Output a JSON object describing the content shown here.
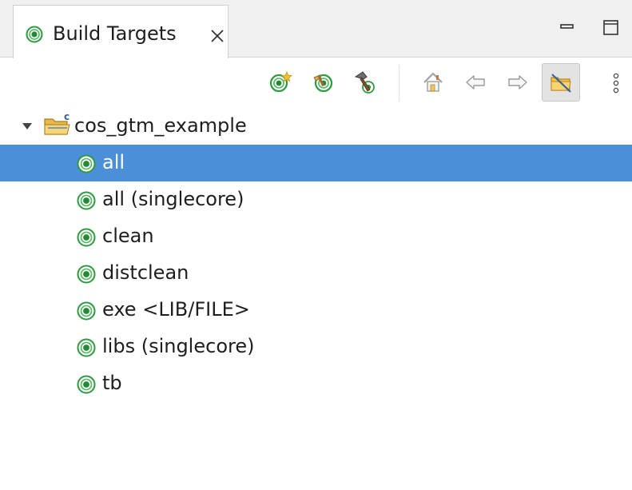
{
  "view": {
    "tab_title": "Build Targets",
    "tab_icon": "build-target-icon",
    "close_icon": "close-icon",
    "minimize_icon": "minimize-icon",
    "maximize_icon": "maximize-icon"
  },
  "toolbar": {
    "buttons": [
      {
        "name": "new-target-icon"
      },
      {
        "name": "edit-target-icon"
      },
      {
        "name": "build-hammer-icon"
      },
      {
        "name": "home-icon"
      },
      {
        "name": "back-arrow-icon"
      },
      {
        "name": "forward-arrow-icon"
      },
      {
        "name": "hide-non-build-folders-icon",
        "active": true
      }
    ],
    "more_icon": "view-menu-icon"
  },
  "tree": {
    "project": {
      "label": "cos_gtm_example",
      "icon": "c-project-folder-icon",
      "expanded": true
    },
    "targets": [
      {
        "label": "all",
        "selected": true
      },
      {
        "label": "all (singlecore)"
      },
      {
        "label": "clean"
      },
      {
        "label": "distclean"
      },
      {
        "label": "exe <LIB/FILE>"
      },
      {
        "label": "libs (singlecore)"
      },
      {
        "label": "tb"
      }
    ]
  },
  "colors": {
    "selection": "#4a8fd8",
    "target_green": "#2e9a3e",
    "tab_bar": "#f0f0f0"
  }
}
